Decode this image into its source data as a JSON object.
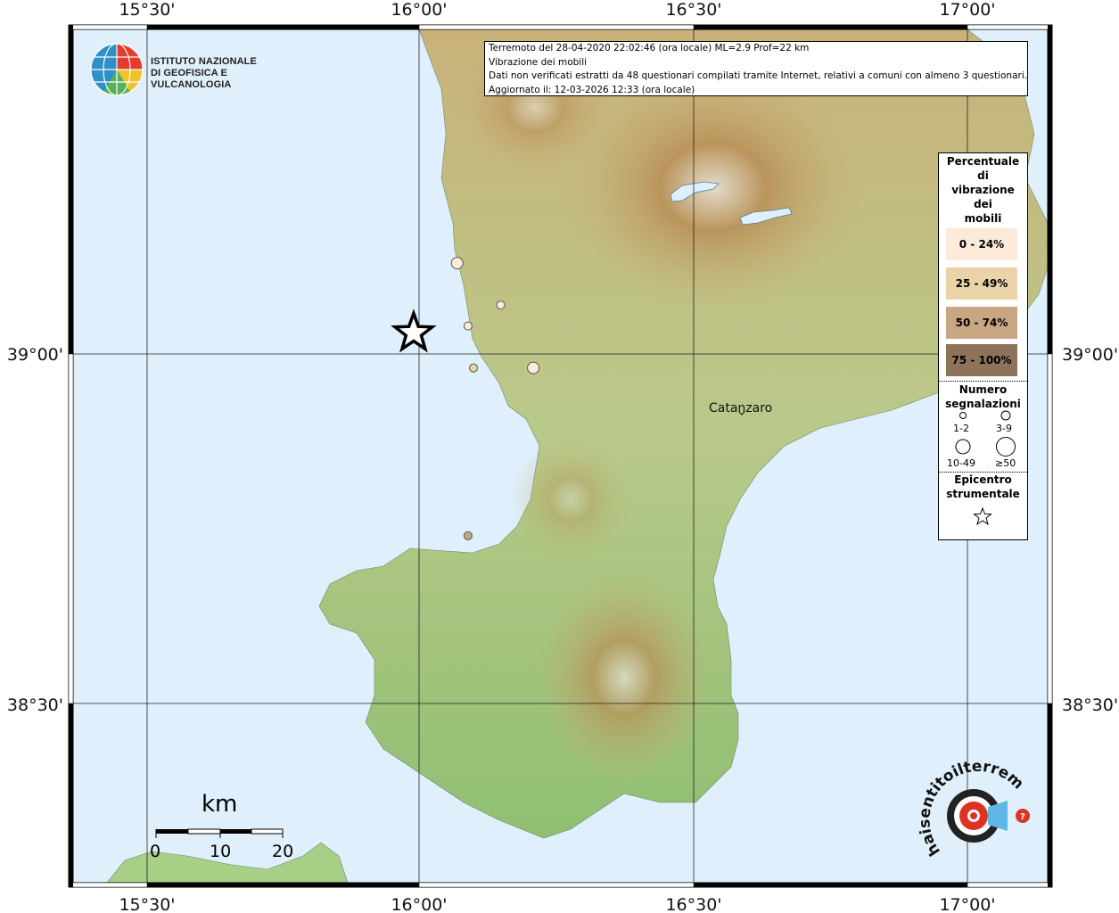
{
  "info": {
    "line1": "Terremoto del 28-04-2020 22:02:46 (ora locale) ML=2.9 Prof=22 km",
    "line2": "Vibrazione dei mobili",
    "line3": "Dati non verificati estratti da 48 questionari compilati tramite Internet, relativi a comuni con almeno 3 questionari.",
    "line4": "Aggiornato il: 12-03-2026 12:33 (ora locale)"
  },
  "logo": {
    "line1": "ISTITUTO NAZIONALE",
    "line2": "DI GEOFISICA E VULCANOLOGIA"
  },
  "axes": {
    "x_ticks": [
      "15°30'",
      "16°00'",
      "16°30'",
      "17°00'"
    ],
    "y_ticks": [
      "39°00'",
      "38°30'"
    ]
  },
  "city": {
    "name": "Catanzaro"
  },
  "legend": {
    "title": "Percentuale di vibrazione dei mobili",
    "title_lines": [
      "Percentuale",
      "di",
      "vibrazione",
      "dei",
      "mobili"
    ],
    "classes": [
      {
        "label": "0 - 24%",
        "color": "#fcebd9"
      },
      {
        "label": "25 - 49%",
        "color": "#ead3a9"
      },
      {
        "label": "50 - 74%",
        "color": "#c8a682"
      },
      {
        "label": "75 - 100%",
        "color": "#8d7359"
      }
    ],
    "size_title_lines": [
      "Numero",
      "segnalazioni"
    ],
    "sizes": [
      "1-2",
      "3-9",
      "10-49",
      "≥50"
    ],
    "epi_title_lines": [
      "Epicentro",
      "strumentale"
    ]
  },
  "scalebar": {
    "unit": "km",
    "labels": [
      "0",
      "10",
      "20"
    ]
  },
  "badge": {
    "text": "haisentitoilterremoto.it",
    "url": "www."
  },
  "map_data": {
    "epicenter": {
      "lon": 15.99,
      "lat": 39.03
    },
    "points": [
      {
        "lon": 16.07,
        "lat": 39.13,
        "class": 0,
        "size": "3-9"
      },
      {
        "lon": 16.15,
        "lat": 39.07,
        "class": 0,
        "size": "1-2"
      },
      {
        "lon": 16.09,
        "lat": 39.04,
        "class": 0,
        "size": "1-2"
      },
      {
        "lon": 16.1,
        "lat": 38.98,
        "class": 1,
        "size": "1-2"
      },
      {
        "lon": 16.21,
        "lat": 38.98,
        "class": 0,
        "size": "3-9"
      },
      {
        "lon": 16.09,
        "lat": 38.74,
        "class": 2,
        "size": "1-2"
      }
    ]
  }
}
